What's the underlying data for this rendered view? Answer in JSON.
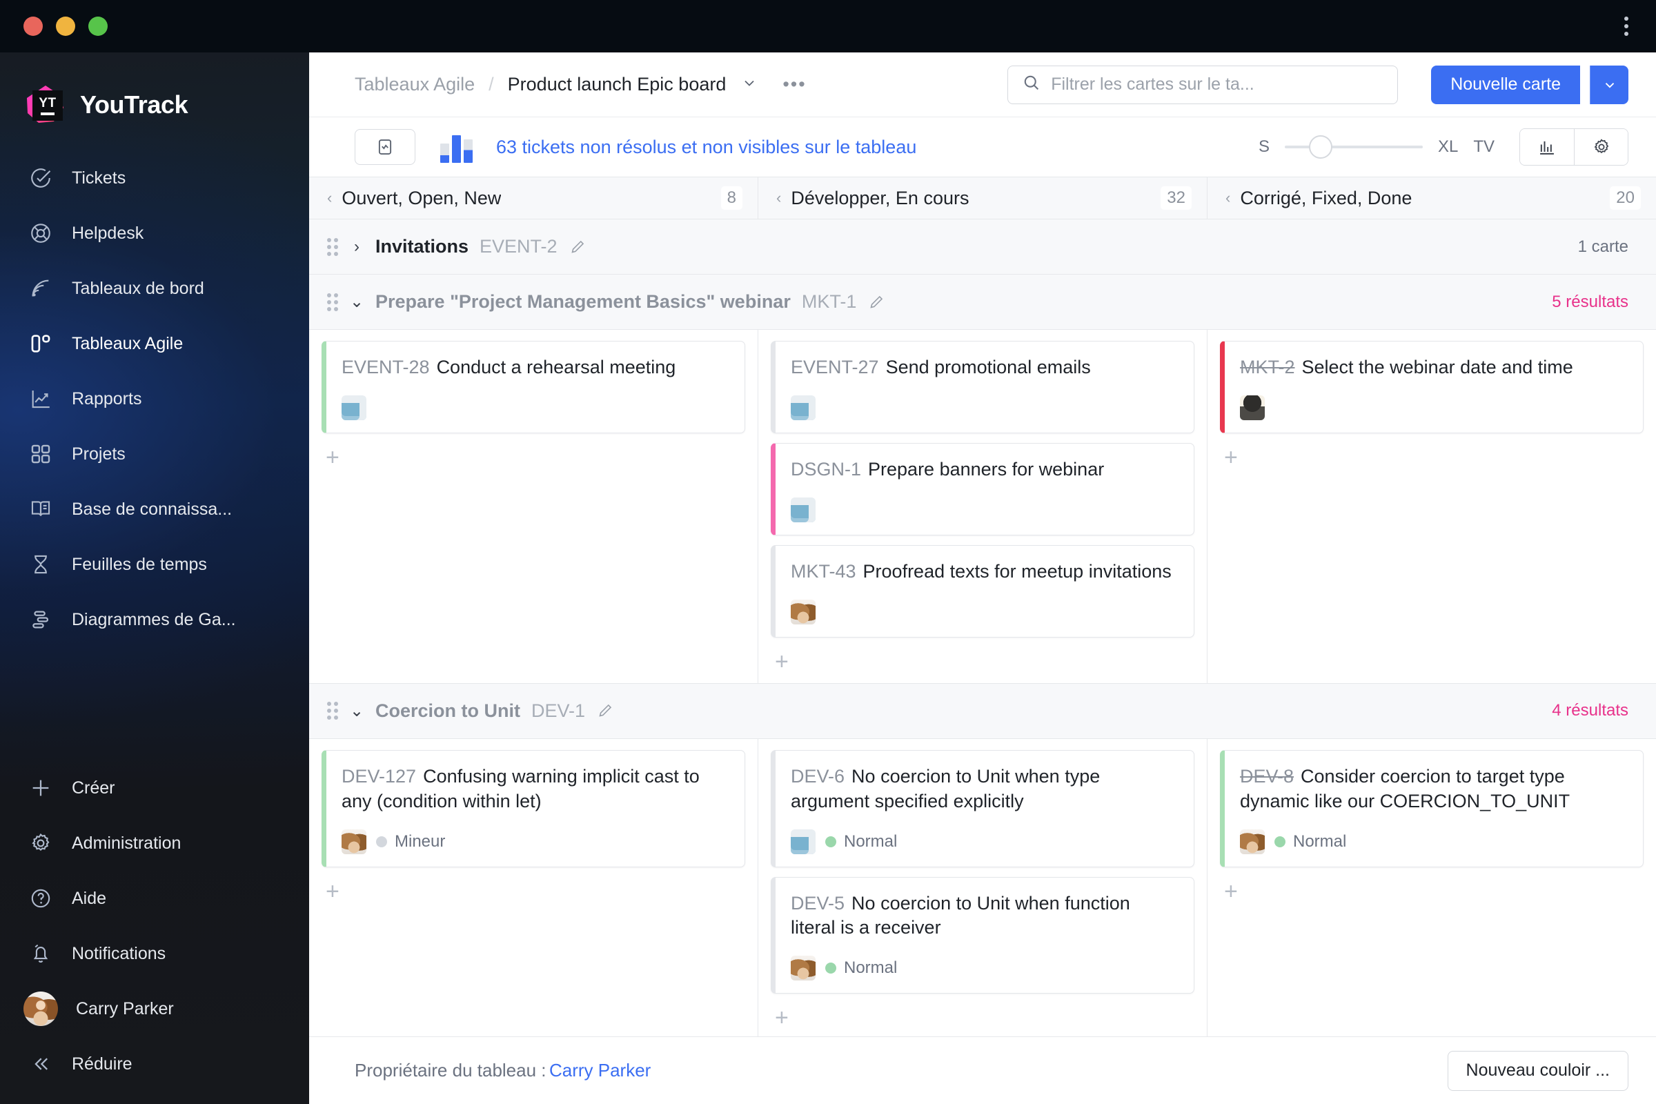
{
  "window": {
    "menu_icon": "kebab-menu-icon"
  },
  "sidebar": {
    "brand": "YouTrack",
    "logo_text": "YT",
    "items": [
      {
        "label": "Tickets",
        "icon": "check-circle-icon",
        "active": false
      },
      {
        "label": "Helpdesk",
        "icon": "lifebuoy-icon",
        "active": false
      },
      {
        "label": "Tableaux de bord",
        "icon": "dashboard-radar-icon",
        "active": false
      },
      {
        "label": "Tableaux Agile",
        "icon": "agile-board-icon",
        "active": true
      },
      {
        "label": "Rapports",
        "icon": "report-chart-icon",
        "active": false
      },
      {
        "label": "Projets",
        "icon": "projects-grid-icon",
        "active": false
      },
      {
        "label": "Base de connaissa...",
        "icon": "book-icon",
        "active": false
      },
      {
        "label": "Feuilles de temps",
        "icon": "hourglass-icon",
        "active": false
      },
      {
        "label": "Diagrammes de Ga...",
        "icon": "gantt-chart-icon",
        "active": false
      }
    ],
    "bottom_items": [
      {
        "label": "Créer",
        "icon": "plus-icon"
      },
      {
        "label": "Administration",
        "icon": "gear-icon"
      },
      {
        "label": "Aide",
        "icon": "question-circle-icon"
      },
      {
        "label": "Notifications",
        "icon": "bell-icon"
      }
    ],
    "user": {
      "name": "Carry Parker",
      "icon": "avatar"
    },
    "collapse": {
      "label": "Réduire",
      "icon": "chevron-double-left-icon"
    }
  },
  "header": {
    "breadcrumb_root": "Tableaux Agile",
    "breadcrumb_sep": "/",
    "breadcrumb_current": "Product launch Epic board",
    "board_dropdown_icon": "chevron-down-icon",
    "more_icon": "ellipsis-icon",
    "search": {
      "placeholder": "Filtrer les cartes sur le ta...",
      "value": "",
      "icon": "search-icon"
    },
    "new_card_label": "Nouvelle carte",
    "new_card_caret_icon": "chevron-down-icon",
    "accent_color": "#3b6ef2"
  },
  "toolbar": {
    "inbox_icon": "card-tray-icon",
    "chart_icon": "bar-chart-icon",
    "alert_text": "63 tickets non résolus et non visibles sur le tableau",
    "alert_color": "#3b6ef2",
    "size_min_label": "S",
    "size_max_label": "XL",
    "tv_label": "TV",
    "slider_value": 26,
    "chart_toggle_icon": "column-chart-icon",
    "settings_icon": "gear-icon"
  },
  "columns": [
    {
      "title": "Ouvert, Open, New",
      "count": "8",
      "collapse_icon": "chevron-left-icon"
    },
    {
      "title": "Développer, En cours",
      "count": "32",
      "collapse_icon": "chevron-left-icon"
    },
    {
      "title": "Corrigé, Fixed, Done",
      "count": "20",
      "collapse_icon": "chevron-left-icon"
    }
  ],
  "swimlanes": [
    {
      "title": "Invitations",
      "id": "EVENT-2",
      "collapsed": true,
      "chevron_icon": "chevron-right-icon",
      "edit_icon": "pencil-icon",
      "right_label": "1 carte",
      "right_kind": "cards",
      "cells": []
    },
    {
      "title": "Prepare \"Project Management Basics\" webinar",
      "id": "MKT-1",
      "collapsed": false,
      "chevron_icon": "chevron-down-icon",
      "edit_icon": "pencil-icon",
      "right_label": "5 résultats",
      "right_kind": "results",
      "cells": [
        {
          "add_icon": "plus-icon",
          "cards": [
            {
              "id": "EVENT-28",
              "title": "Conduct a rehearsal meeting",
              "resolved": false,
              "border": "#a8dfb4",
              "avatar": "a1",
              "priority": null
            }
          ]
        },
        {
          "add_icon": "plus-icon",
          "cards": [
            {
              "id": "EVENT-27",
              "title": "Send promotional emails",
              "resolved": false,
              "border": "#e4e6ea",
              "avatar": "a1",
              "priority": null
            },
            {
              "id": "DSGN-1",
              "title": "Prepare banners for webinar",
              "resolved": false,
              "border": "#f469ae",
              "avatar": "a1",
              "priority": null
            },
            {
              "id": "MKT-43",
              "title": "Proofread texts for meetup invitations",
              "resolved": false,
              "border": "#e4e6ea",
              "avatar": "a3",
              "priority": null
            }
          ]
        },
        {
          "add_icon": "plus-icon",
          "cards": [
            {
              "id": "MKT-2",
              "title": "Select the webinar date and time",
              "resolved": true,
              "border": "#e8384f",
              "avatar": "a2",
              "priority": null
            }
          ]
        }
      ]
    },
    {
      "title": "Coercion to Unit",
      "id": "DEV-1",
      "collapsed": false,
      "chevron_icon": "chevron-down-icon",
      "edit_icon": "pencil-icon",
      "right_label": "4 résultats",
      "right_kind": "results",
      "cells": [
        {
          "add_icon": "plus-icon",
          "cards": [
            {
              "id": "DEV-127",
              "title": "Confusing warning implicit cast to any (condition within let)",
              "resolved": false,
              "border": "#a8dfb4",
              "avatar": "a3",
              "priority": {
                "label": "Mineur",
                "color": "#d3d7dd"
              }
            }
          ]
        },
        {
          "add_icon": "plus-icon",
          "cards": [
            {
              "id": "DEV-6",
              "title": "No coercion to Unit when type argument specified explicitly",
              "resolved": false,
              "border": "#e4e6ea",
              "avatar": "a1",
              "priority": {
                "label": "Normal",
                "color": "#9ad7ab"
              }
            },
            {
              "id": "DEV-5",
              "title": "No coercion to Unit when function literal is a receiver",
              "resolved": false,
              "border": "#e4e6ea",
              "avatar": "a3",
              "priority": {
                "label": "Normal",
                "color": "#9ad7ab"
              }
            }
          ]
        },
        {
          "add_icon": "plus-icon",
          "cards": [
            {
              "id": "DEV-8",
              "title": "Consider coercion to target type dynamic like our COERCION_TO_UNIT",
              "resolved": true,
              "border": "#a8dfb4",
              "avatar": "a3",
              "priority": {
                "label": "Normal",
                "color": "#9ad7ab"
              }
            }
          ]
        }
      ]
    }
  ],
  "footer": {
    "owner_label": "Propriétaire du tableau :",
    "owner_name": "Carry Parker",
    "new_swimlane_label": "Nouveau couloir ..."
  }
}
